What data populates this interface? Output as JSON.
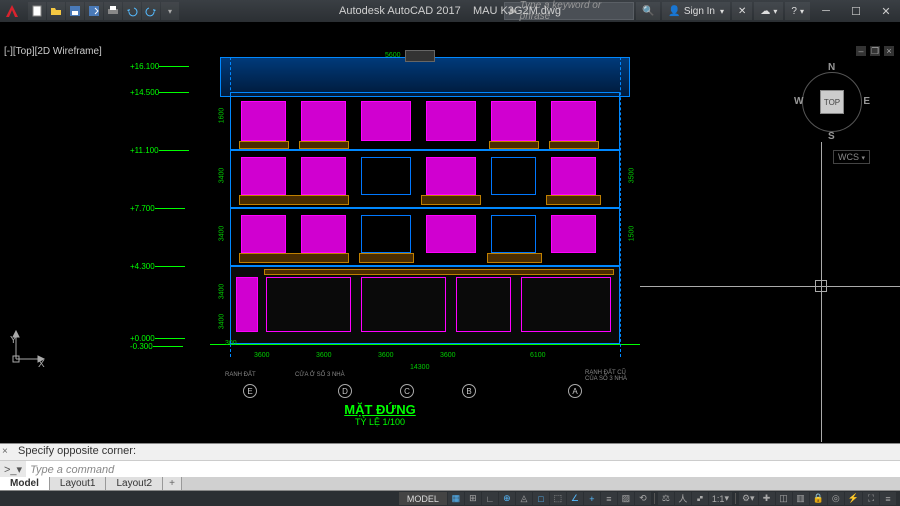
{
  "title": {
    "app": "Autodesk AutoCAD 2017",
    "file": "MAU K3G2M.dwg"
  },
  "search": {
    "placeholder": "Type a keyword or phrase"
  },
  "signin": {
    "label": "Sign In"
  },
  "viewport": {
    "label": "[-][Top][2D Wireframe]"
  },
  "viewcube": {
    "face": "TOP",
    "n": "N",
    "s": "S",
    "e": "E",
    "w": "W",
    "wcs": "WCS"
  },
  "ucs": {
    "x": "X",
    "y": "Y"
  },
  "elevations": [
    "+16.100",
    "+14.500",
    "+11.100",
    "+7.700",
    "+4.300",
    "+0.000",
    "-0.300"
  ],
  "dims_top": [
    "5600"
  ],
  "dims_bottom": [
    "3600",
    "3600",
    "3600",
    "3600",
    "6100"
  ],
  "dims_total": "14300",
  "grid_bubbles": [
    "E",
    "D",
    "C",
    "B",
    "A"
  ],
  "grid_notes_left": "RANH ĐẤT",
  "grid_notes_mid": "CỬA Ở SỐ 3 NHÀ",
  "grid_notes_right": "RANH ĐẤT CŨ CỦA  SỐ 3 NHÀ",
  "elevation_side_dims": [
    "3400",
    "3400",
    "3400",
    "3400",
    "1600"
  ],
  "elevation_side_dims_right": [
    "3500",
    "1500"
  ],
  "ground_dim": "300",
  "dwg_title": {
    "main": "MẶT ĐỨNG",
    "sub": "TỶ LỆ 1/100"
  },
  "cmd": {
    "hist": "Specify opposite corner:",
    "placeholder": "Type a command",
    "prompt": ">_"
  },
  "tabs": [
    "Model",
    "Layout1",
    "Layout2"
  ],
  "status": {
    "space": "MODEL",
    "scale": "1:1"
  }
}
